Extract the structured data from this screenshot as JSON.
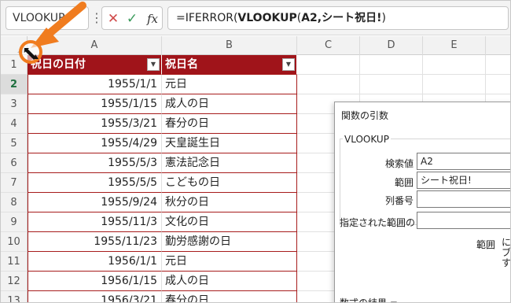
{
  "formula_bar": {
    "name_box": "VLOOKUP",
    "formula_prefix": "=IFERROR(",
    "formula_bold": "VLOOKUP",
    "formula_mid": "(",
    "formula_bold2": "A2,シート祝日!",
    "formula_suffix": ")"
  },
  "columns": [
    "A",
    "B",
    "C",
    "D",
    "E"
  ],
  "row_numbers": [
    "1",
    "2",
    "3",
    "4",
    "5",
    "6",
    "7",
    "8",
    "9",
    "10",
    "11",
    "12",
    "13"
  ],
  "table": {
    "header": [
      "祝日の日付",
      "祝日名"
    ],
    "rows": [
      [
        "1955/1/1",
        "元日"
      ],
      [
        "1955/1/15",
        "成人の日"
      ],
      [
        "1955/3/21",
        "春分の日"
      ],
      [
        "1955/4/29",
        "天皇誕生日"
      ],
      [
        "1955/5/3",
        "憲法記念日"
      ],
      [
        "1955/5/5",
        "こどもの日"
      ],
      [
        "1955/9/24",
        "秋分の日"
      ],
      [
        "1955/11/3",
        "文化の日"
      ],
      [
        "1955/11/23",
        "勤労感謝の日"
      ],
      [
        "1956/1/1",
        "元日"
      ],
      [
        "1956/1/15",
        "成人の日"
      ],
      [
        "1956/3/21",
        "春分の日"
      ]
    ]
  },
  "dialog": {
    "title": "関数の引数",
    "function_name": "VLOOKUP",
    "args": [
      {
        "label": "検索値",
        "value": "A2"
      },
      {
        "label": "範囲",
        "value": "シート祝日!"
      },
      {
        "label": "列番号",
        "value": ""
      },
      {
        "label": "指定された範囲の左",
        "value": ""
      }
    ],
    "desc_label": "範囲",
    "desc_text": "に\nブ\nす",
    "result_label": "数式の結果 ="
  },
  "colors": {
    "table_header_bg": "#a0141a",
    "annotation_arrow": "#f07c1f"
  },
  "icons": [
    "kebab-icon",
    "cancel-icon",
    "enter-icon",
    "fx-icon",
    "filter-dropdown-icon",
    "select-all-triangle-icon",
    "arrow-annotation-icon",
    "circle-highlight-icon",
    "cursor-icon"
  ]
}
